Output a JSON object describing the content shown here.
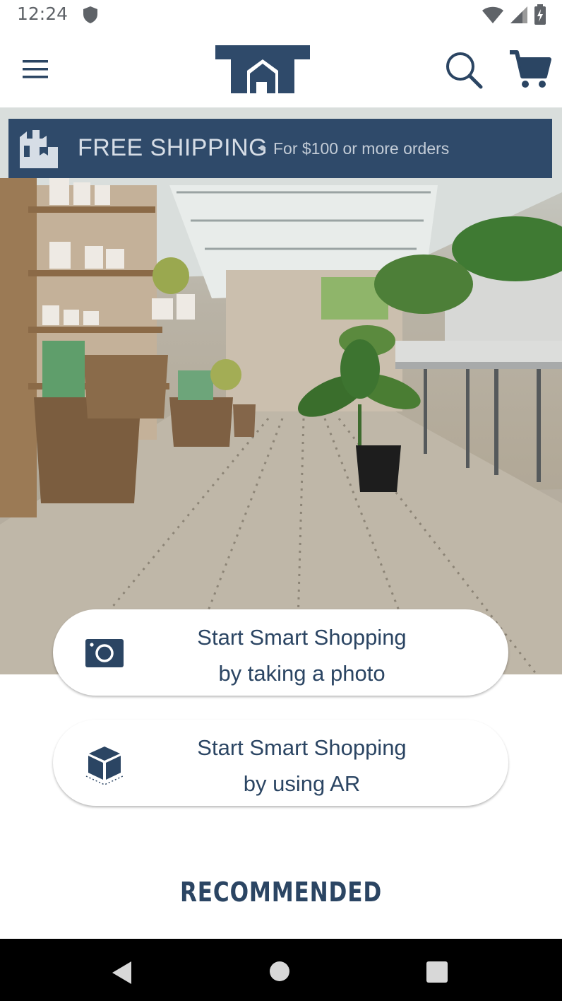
{
  "status_bar": {
    "time": "12:24",
    "icons": [
      "shield-icon",
      "wifi-icon",
      "signal-icon",
      "battery-charging-icon"
    ]
  },
  "header": {
    "menu_icon": "hamburger-menu-icon",
    "logo_icon": "store-logo",
    "search_icon": "search-icon",
    "cart_icon": "cart-icon"
  },
  "banner": {
    "title": "FREE SHIPPING",
    "separator": "•",
    "subtitle": "For $100 or more orders",
    "icon": "shipping-boxes-icon"
  },
  "actions": [
    {
      "line1": "Start Smart Shopping",
      "line2": "by taking a photo",
      "icon": "camera-icon"
    },
    {
      "line1": "Start Smart Shopping",
      "line2": "by using AR",
      "icon": "ar-cube-icon"
    }
  ],
  "section_title": "RECOMMENDED",
  "colors": {
    "brand_navy": "#2b4563",
    "banner_bg": "#2f4a6a",
    "nav_bar": "#000000"
  },
  "nav_bar": {
    "icons": [
      "back-icon",
      "home-icon",
      "recents-icon"
    ]
  }
}
